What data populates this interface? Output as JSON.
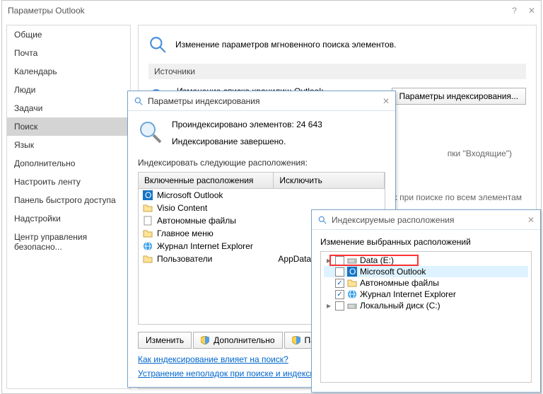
{
  "outer": {
    "title": "Параметры Outlook",
    "help_glyph": "?",
    "close_glyph": "✕",
    "sidebar": [
      "Общие",
      "Почта",
      "Календарь",
      "Люди",
      "Задачи",
      "Поиск",
      "Язык",
      "Дополнительно",
      "Настроить ленту",
      "Панель быстрого доступа",
      "Надстройки",
      "Центр управления безопасно..."
    ],
    "main_heading": "Изменение параметров мгновенного поиска элементов.",
    "section_sources": "Источники",
    "sources_text": "Изменение списка хранилищ Outlook, индексируемых Windows Search",
    "sources_btn": "Параметры индексирования...",
    "result_fragment": "пки \"Входящие\")",
    "fragment2": "ных при поиске по всем элементам"
  },
  "index": {
    "title": "Параметры индексирования",
    "close_glyph": "✕",
    "count_line": "Проиндексировано элементов: 24 643",
    "done_line": "Индексирование завершено.",
    "loc_label": "Индексировать следующие расположения:",
    "col_included": "Включенные расположения",
    "col_excluded": "Исключить",
    "rows": [
      {
        "name": "Microsoft Outlook",
        "excl": ""
      },
      {
        "name": "Visio Content",
        "excl": ""
      },
      {
        "name": "Автономные файлы",
        "excl": ""
      },
      {
        "name": "Главное меню",
        "excl": ""
      },
      {
        "name": "Журнал Internet Explorer",
        "excl": ""
      },
      {
        "name": "Пользователи",
        "excl": "AppData; App..."
      }
    ],
    "btn_modify": "Изменить",
    "btn_advanced": "Дополнительно",
    "btn_pause": "Пау",
    "link_how": "Как индексирование влияет на поиск?",
    "link_trouble": "Устранение неполадок при поиске и индексировании"
  },
  "loc": {
    "title": "Индексируемые расположения",
    "close_glyph": "✕",
    "change_label": "Изменение выбранных расположений",
    "tree": [
      {
        "tw": "▸",
        "checked": false,
        "name": "Data (E:)",
        "icon": "drive"
      },
      {
        "tw": "",
        "checked": false,
        "name": "Microsoft Outlook",
        "icon": "outlook",
        "sel": true
      },
      {
        "tw": "",
        "checked": true,
        "name": "Автономные файлы",
        "icon": "folder"
      },
      {
        "tw": "",
        "checked": true,
        "name": "Журнал Internet Explorer",
        "icon": "ie"
      },
      {
        "tw": "▸",
        "checked": false,
        "name": "Локальный диск (C:)",
        "icon": "drive"
      }
    ]
  }
}
